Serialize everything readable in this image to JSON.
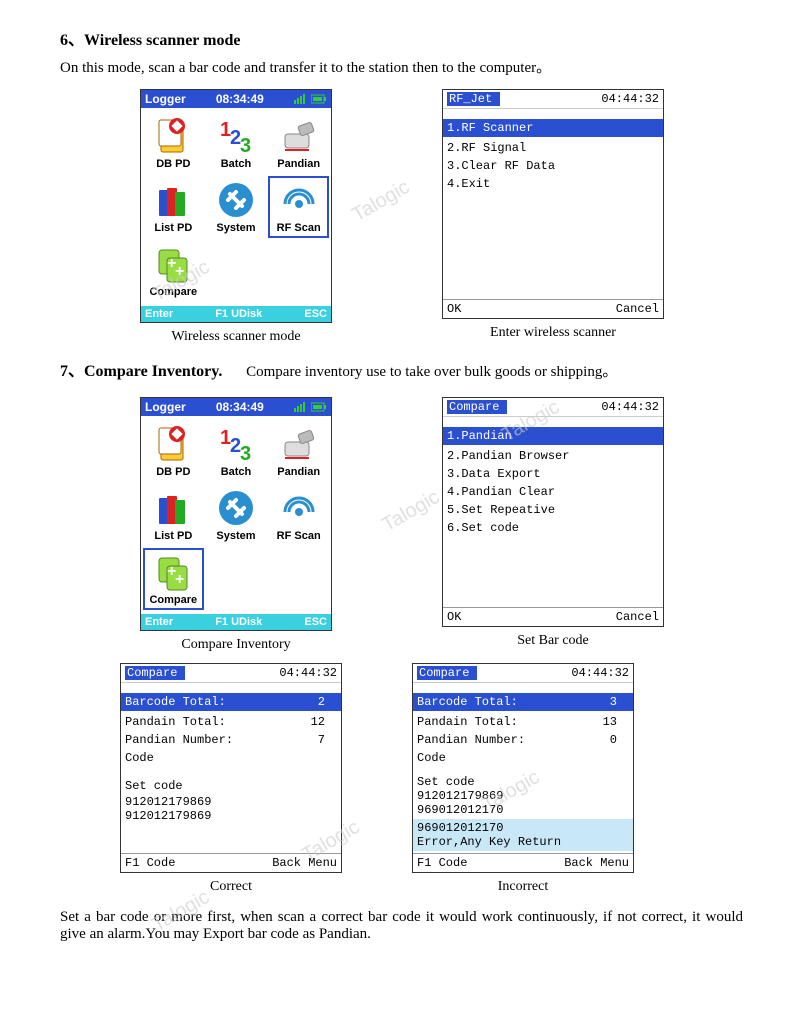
{
  "section6": {
    "heading": "6、Wireless scanner mode",
    "desc": "On this mode, scan a bar code and transfer it to the station then to the computer。"
  },
  "section7": {
    "heading": "7、Compare Inventory.",
    "desc": "Compare inventory use to take over bulk goods or shipping。"
  },
  "footerPara": "Set a bar code or more first, when scan a correct bar code it would work continuously, if not correct, it would give an alarm.You may Export bar code as Pandian.",
  "device": {
    "titlebarLeft": "Logger",
    "time": "08:34:49",
    "bottomLeft": "Enter",
    "bottomMid": "F1 UDisk",
    "bottomRight": "ESC",
    "apps": [
      {
        "name": "DB PD"
      },
      {
        "name": "Batch"
      },
      {
        "name": "Pandian"
      },
      {
        "name": "List PD"
      },
      {
        "name": "System"
      },
      {
        "name": "RF Scan"
      },
      {
        "name": "Compare"
      }
    ]
  },
  "captions": {
    "wireless": "Wireless scanner mode",
    "enterWireless": "Enter wireless scanner",
    "compareInv": "Compare Inventory",
    "setBarcode": "Set Bar code",
    "correct": "Correct",
    "incorrect": "Incorrect"
  },
  "rfJet": {
    "title": "RF_Jet",
    "time": "04:44:32",
    "items": [
      "1.RF Scanner",
      "2.RF Signal",
      "3.Clear RF Data",
      "4.Exit"
    ],
    "ok": "OK",
    "cancel": "Cancel"
  },
  "compareMenu": {
    "title": "Compare",
    "time": "04:44:32",
    "items": [
      "1.Pandian",
      "2.Pandian Browser",
      "3.Data Export",
      "4.Pandian Clear",
      "5.Set Repeative",
      "6.Set code"
    ],
    "ok": "OK",
    "cancel": "Cancel"
  },
  "correctScreen": {
    "title": "Compare",
    "time": "04:44:32",
    "barcodeLabel": "Barcode Total:",
    "barcodeVal": "2",
    "pandainLabel": "Pandain Total:",
    "pandainVal": "12",
    "numberLabel": "Pandian Number:",
    "numberVal": "7",
    "codeLabel": "Code",
    "setCode": "Set code",
    "codes": [
      "912012179869",
      "912012179869"
    ],
    "footLeft": "F1 Code",
    "footRight": "Back Menu"
  },
  "incorrectScreen": {
    "title": "Compare",
    "time": "04:44:32",
    "barcodeLabel": "Barcode Total:",
    "barcodeVal": "3",
    "pandainLabel": "Pandain Total:",
    "pandainVal": "13",
    "numberLabel": "Pandian Number:",
    "numberVal": "0",
    "codeLabel": "Code",
    "setCode": "Set code",
    "codes": [
      "912012179869",
      "969012012170"
    ],
    "errCode": "969012012170",
    "errMsg": "Error,Any Key Return",
    "footLeft": "F1 Code",
    "footRight": "Back Menu"
  },
  "watermark": "Talogic"
}
